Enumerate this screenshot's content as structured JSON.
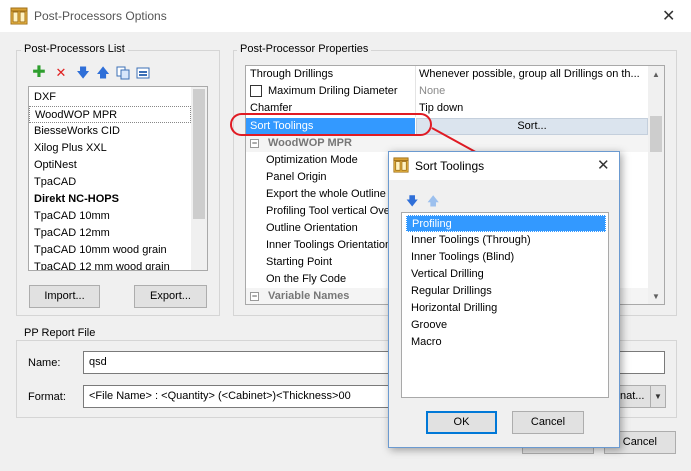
{
  "window": {
    "title": "Post-Processors Options"
  },
  "pp_list": {
    "label": "Post-Processors List",
    "items": [
      "DXF",
      "WoodWOP MPR",
      "BiesseWorks CID",
      "Xilog Plus XXL",
      "OptiNest",
      "TpaCAD",
      "Direkt NC-HOPS",
      "TpaCAD 10mm",
      "TpaCAD 12mm",
      "TpaCAD 10mm wood grain",
      "TpaCAD 12 mm wood grain"
    ],
    "selected_index": 1,
    "bold_index": 6,
    "import_label": "Import...",
    "export_label": "Export..."
  },
  "pp_props": {
    "label": "Post-Processor Properties",
    "rows": [
      {
        "name": "Through Drillings",
        "value": "Whenever possible, group all Drillings on th..."
      },
      {
        "name": "Maximum Driling Diameter",
        "value": "None"
      },
      {
        "name": "Chamfer",
        "value": "Tip down"
      },
      {
        "name": "Sort Toolings",
        "value": "Sort..."
      }
    ],
    "category_wood": "WoodWOP MPR",
    "wood_rows": [
      "Optimization Mode",
      "Panel Origin",
      "Export the whole Outline",
      "Profiling Tool vertical Ove",
      "Outline Orientation",
      "Inner Toolings Orientation",
      "Starting Point",
      "On the Fly Code"
    ],
    "category_var": "Variable Names"
  },
  "report": {
    "label": "PP Report File",
    "name_label": "Name:",
    "name_value": "qsd",
    "format_label": "Format:",
    "format_value": "<File Name> : <Quantity> (<Cabinet>)<Thickness>00",
    "format_btn": "nat...",
    "cancel_label": "Cancel"
  },
  "sort_dialog": {
    "title": "Sort Toolings",
    "items": [
      "Profiling",
      "Inner Toolings (Through)",
      "Inner Toolings (Blind)",
      "Vertical Drilling",
      "Regular Drillings",
      "Horizontal Drilling",
      "Groove",
      "Macro"
    ],
    "selected_index": 0,
    "ok_label": "OK",
    "cancel_label": "Cancel"
  },
  "colors": {
    "selection": "#3399ff",
    "highlight_annotation": "#e01b24",
    "add_icon": "#2e9e2e",
    "delete_icon": "#e02020",
    "arrow_icon": "#2f6fd8"
  }
}
